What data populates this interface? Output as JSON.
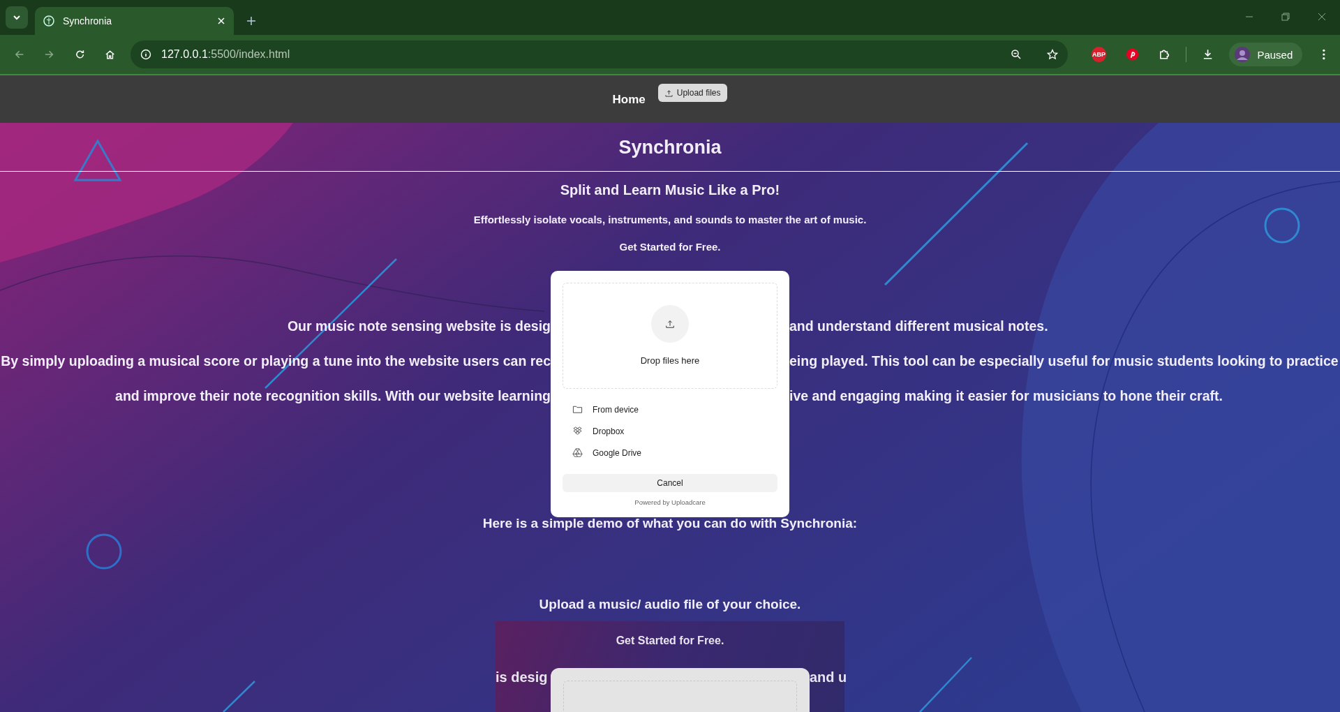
{
  "browser": {
    "tab": {
      "title": "Synchronia",
      "selected": true
    },
    "address": {
      "host": "127.0.0.1",
      "path": ":5500/index.html"
    },
    "extension_badge": "ABP",
    "profile": {
      "status": "Paused"
    }
  },
  "nav": {
    "home": "Home",
    "upload_button": "Upload files"
  },
  "hero": {
    "title": "Synchronia",
    "subtitle": "Split and Learn Music Like a Pro!",
    "tagline": "Effortlessly isolate vocals, instruments, and sounds to master the art of music.",
    "cta": "Get Started for Free."
  },
  "about_lines": [
    {
      "left": "Our music note sensing website is desig",
      "right": "and understand different musical notes."
    },
    {
      "left": "By simply uploading a musical score or playing a tune into the website users can rec",
      "right": "eing played. This tool can be especially useful for music students looking to practice"
    },
    {
      "left": "and improve their note recognition skills. With our website learning",
      "right": "ive and engaging making it easier for musicians to hone their craft."
    }
  ],
  "demo_heading": "Here is a simple demo of what you can do with Synchronia:",
  "upload_prompt": "Upload a music/ audio file of your choice.",
  "embedded_preview": {
    "cta": "Get Started for Free.",
    "line": {
      "left": "is desig",
      "right": "and u"
    }
  },
  "upload_dialog": {
    "drop_label": "Drop files here",
    "sources": [
      {
        "label": "From device",
        "kind": "device"
      },
      {
        "label": "Dropbox",
        "kind": "dropbox"
      },
      {
        "label": "Google Drive",
        "kind": "drive"
      }
    ],
    "cancel": "Cancel",
    "powered_by": "Powered by Uploadcare"
  }
}
